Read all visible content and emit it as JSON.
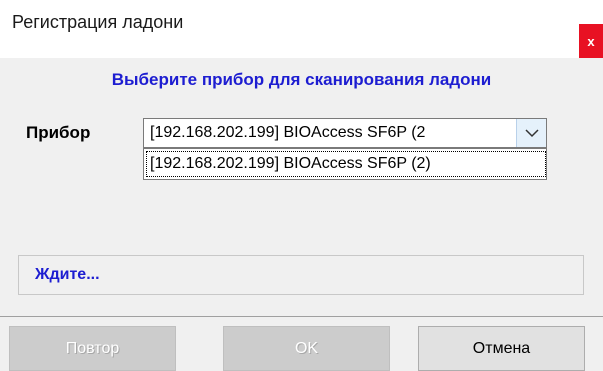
{
  "window": {
    "title": "Регистрация ладони",
    "close_label": "x"
  },
  "header": {
    "text": "Выберите прибор для сканирования ладони"
  },
  "device": {
    "label": "Прибор",
    "selected": "[192.168.202.199] BIOAccess SF6P (2",
    "options": [
      "[192.168.202.199] BIOAccess SF6P (2)"
    ]
  },
  "status": {
    "text": "Ждите..."
  },
  "buttons": {
    "retry": "Повтор",
    "ok": "OK",
    "cancel": "Отмена"
  },
  "colors": {
    "accent_text": "#1d1dd1",
    "close_bg": "#e81123"
  }
}
